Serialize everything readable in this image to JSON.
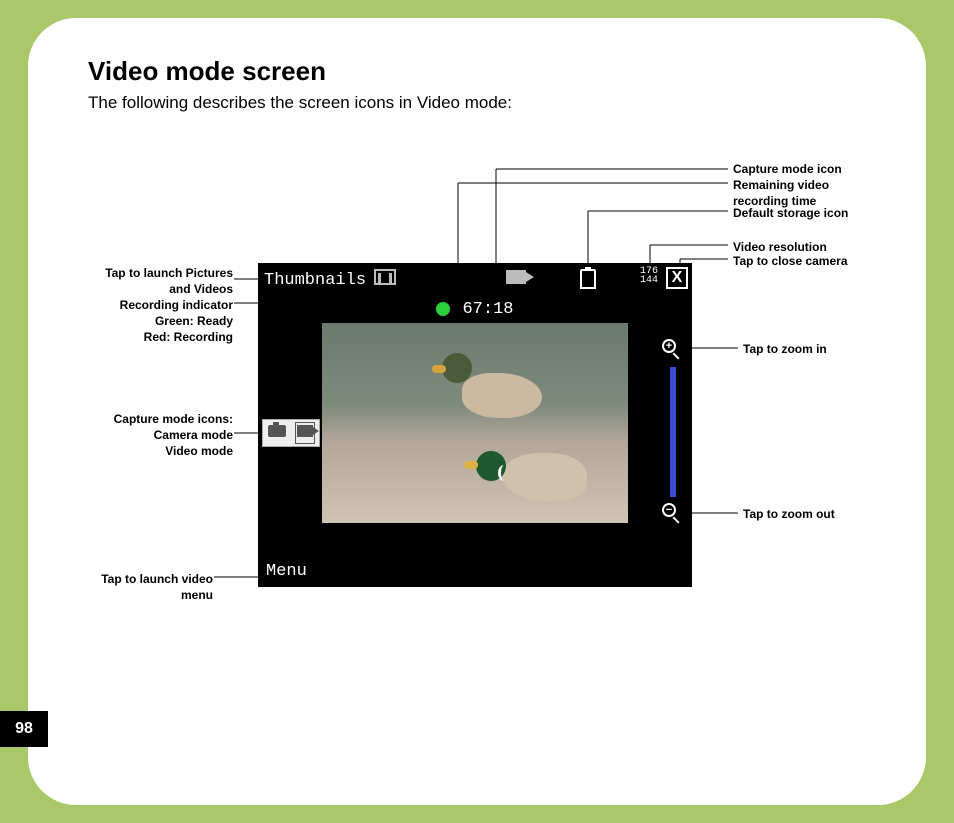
{
  "page": {
    "title": "Video mode screen",
    "intro": "The following describes the screen icons in Video mode:",
    "number": "98"
  },
  "device": {
    "thumbnails_label": "Thumbnails",
    "recording_time": "67:18",
    "menu_label": "Menu",
    "resolution_top": "176",
    "resolution_bottom": "144",
    "close_symbol": "X",
    "zoom_in_symbol": "+",
    "zoom_out_symbol": "−"
  },
  "callouts": {
    "thumbnails": "Tap to launch Pictures and Videos",
    "recording_indicator_l1": "Recording indicator",
    "recording_indicator_l2": "Green: Ready",
    "recording_indicator_l3": "Red: Recording",
    "capture_modes_l1": "Capture mode icons:",
    "capture_modes_l2": "Camera mode",
    "capture_modes_l3": "Video mode",
    "menu": "Tap to launch video menu",
    "capture_mode_icon": "Capture mode icon",
    "remaining_time_l1": "Remaining video",
    "remaining_time_l2": "recording time",
    "storage": "Default storage icon",
    "resolution": "Video resolution",
    "close": "Tap to close camera",
    "zoom_in": "Tap to zoom in",
    "zoom_out": "Tap to zoom out"
  }
}
